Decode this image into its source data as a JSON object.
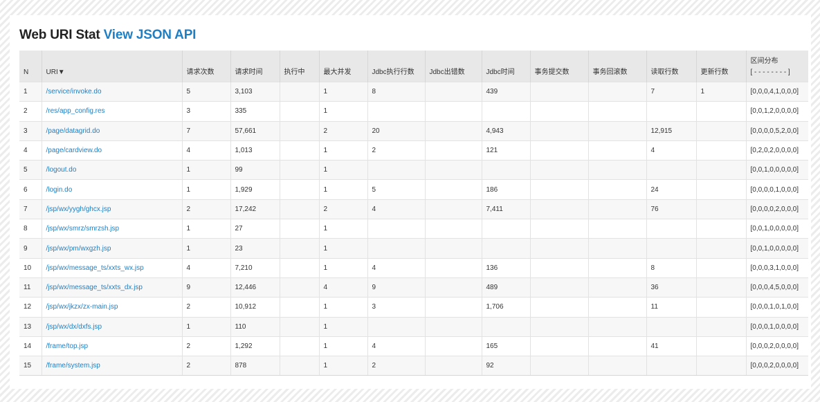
{
  "title": {
    "text": "Web URI Stat",
    "link": "View JSON API"
  },
  "table": {
    "headers": [
      "N",
      "URI▼",
      "请求次数",
      "请求时间",
      "执行中",
      "最大并发",
      "Jdbc执行行数",
      "Jdbc出错数",
      "Jdbc时间",
      "事务提交数",
      "事务回滚数",
      "读取行数",
      "更新行数",
      "区间分布"
    ],
    "range_header": "[ - - - - - - - - ]",
    "rows": [
      [
        "1",
        "/service/invoke.do",
        "5",
        "3,103",
        "",
        "1",
        "8",
        "",
        "439",
        "",
        "",
        "7",
        "1",
        "[0,0,0,4,1,0,0,0]"
      ],
      [
        "2",
        "/res/app_config.res",
        "3",
        "335",
        "",
        "1",
        "",
        "",
        "",
        "",
        "",
        "",
        "",
        "[0,0,1,2,0,0,0,0]"
      ],
      [
        "3",
        "/page/datagrid.do",
        "7",
        "57,661",
        "",
        "2",
        "20",
        "",
        "4,943",
        "",
        "",
        "12,915",
        "",
        "[0,0,0,0,5,2,0,0]"
      ],
      [
        "4",
        "/page/cardview.do",
        "4",
        "1,013",
        "",
        "1",
        "2",
        "",
        "121",
        "",
        "",
        "4",
        "",
        "[0,2,0,2,0,0,0,0]"
      ],
      [
        "5",
        "/logout.do",
        "1",
        "99",
        "",
        "1",
        "",
        "",
        "",
        "",
        "",
        "",
        "",
        "[0,0,1,0,0,0,0,0]"
      ],
      [
        "6",
        "/login.do",
        "1",
        "1,929",
        "",
        "1",
        "5",
        "",
        "186",
        "",
        "",
        "24",
        "",
        "[0,0,0,0,1,0,0,0]"
      ],
      [
        "7",
        "/jsp/wx/yygh/ghcx.jsp",
        "2",
        "17,242",
        "",
        "2",
        "4",
        "",
        "7,411",
        "",
        "",
        "76",
        "",
        "[0,0,0,0,2,0,0,0]"
      ],
      [
        "8",
        "/jsp/wx/smrz/smrzsh.jsp",
        "1",
        "27",
        "",
        "1",
        "",
        "",
        "",
        "",
        "",
        "",
        "",
        "[0,0,1,0,0,0,0,0]"
      ],
      [
        "9",
        "/jsp/wx/pm/wxgzh.jsp",
        "1",
        "23",
        "",
        "1",
        "",
        "",
        "",
        "",
        "",
        "",
        "",
        "[0,0,1,0,0,0,0,0]"
      ],
      [
        "10",
        "/jsp/wx/message_ts/xxts_wx.jsp",
        "4",
        "7,210",
        "",
        "1",
        "4",
        "",
        "136",
        "",
        "",
        "8",
        "",
        "[0,0,0,3,1,0,0,0]"
      ],
      [
        "11",
        "/jsp/wx/message_ts/xxts_dx.jsp",
        "9",
        "12,446",
        "",
        "4",
        "9",
        "",
        "489",
        "",
        "",
        "36",
        "",
        "[0,0,0,4,5,0,0,0]"
      ],
      [
        "12",
        "/jsp/wx/jkzx/zx-main.jsp",
        "2",
        "10,912",
        "",
        "1",
        "3",
        "",
        "1,706",
        "",
        "",
        "11",
        "",
        "[0,0,0,1,0,1,0,0]"
      ],
      [
        "13",
        "/jsp/wx/dx/dxfs.jsp",
        "1",
        "110",
        "",
        "1",
        "",
        "",
        "",
        "",
        "",
        "",
        "",
        "[0,0,0,1,0,0,0,0]"
      ],
      [
        "14",
        "/frame/top.jsp",
        "2",
        "1,292",
        "",
        "1",
        "4",
        "",
        "165",
        "",
        "",
        "41",
        "",
        "[0,0,0,2,0,0,0,0]"
      ],
      [
        "15",
        "/frame/system.jsp",
        "2",
        "878",
        "",
        "1",
        "2",
        "",
        "92",
        "",
        "",
        "",
        "",
        "[0,0,0,2,0,0,0,0]"
      ]
    ]
  },
  "colors": {
    "link": "#1f7fc5",
    "header_bg": "#e8e8e8",
    "row_alt": "#f7f7f7"
  }
}
